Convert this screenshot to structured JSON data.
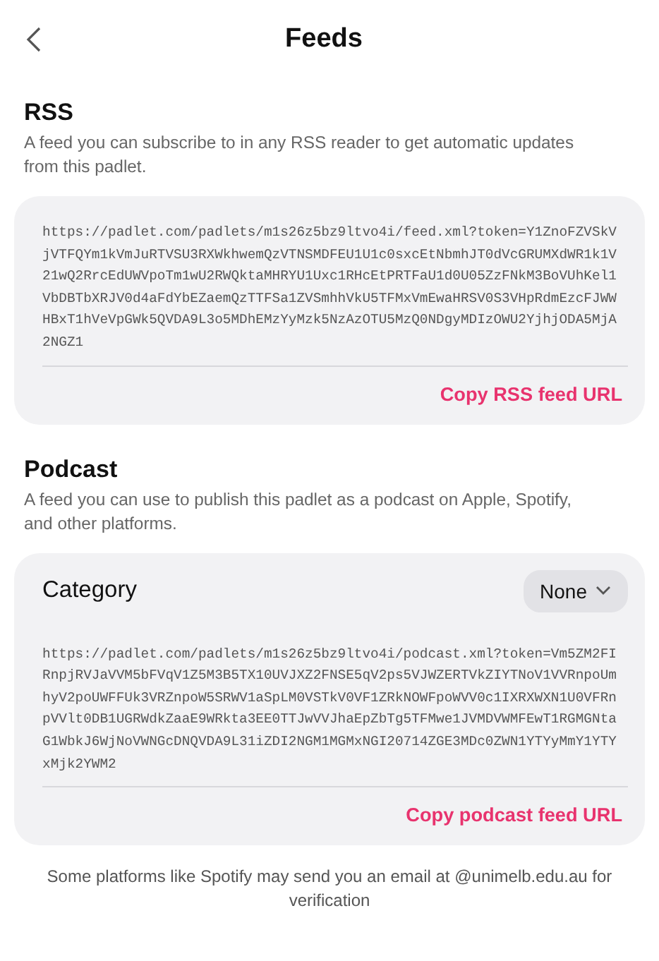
{
  "header": {
    "title": "Feeds"
  },
  "rss": {
    "heading": "RSS",
    "description": "A feed you can subscribe to in any RSS reader to get automatic updates from this padlet.",
    "url": "https://padlet.com/padlets/m1s26z5bz9ltvo4i/feed.xml?token=Y1ZnoFZVSkVjVTFQYm1kVmJuRTVSU3RXWkhwemQzVTNSMDFEU1U1c0sxcEtNbmhJT0dVcGRUMXdWR1k1V21wQ2RrcEdUWVpoTm1wU2RWQktaMHRYU1Uxc1RHcEtPRTFaU1d0U05ZzFNkM3BoVUhKel1VbDBTbXRJV0d4aFdYbEZaemQzTTFSa1ZVSmhhVkU5TFMxVmEwaHRSV0S3VHpRdmEzcFJWWHBxT1hVeVpGWk5QVDA9L3o5MDhEMzYyMzk5NzAzOTU5MzQ0NDgyMDIzOWU2YjhjODA5MjA2NGZ1",
    "copy_button": "Copy RSS feed URL"
  },
  "podcast": {
    "heading": "Podcast",
    "description": "A feed you can use to publish this padlet as a podcast on Apple, Spotify, and other platforms.",
    "category_label": "Category",
    "category_value": "None",
    "url": "https://padlet.com/padlets/m1s26z5bz9ltvo4i/podcast.xml?token=Vm5ZM2FIRnpjRVJaVVM5bFVqV1Z5M3B5TX10UVJXZ2FNSE5qV2ps5VJWZERTVkZIYTNoV1VVRnpoUmhyV2poUWFFUk3VRZnpoW5SRWV1aSpLM0VSTkV0VF1ZRkNOWFpoWVV0c1IXRXWXN1U0VFRnpVVlt0DB1UGRWdkZaaE9WRkta3EE0TTJwVVJhaEpZbTg5TFMwe1JVMDVWMFEwT1RGMGNtaG1WbkJ6WjNoVWNGcDNQVDA9L31iZDI2NGM1MGMxNGI20714ZGE3MDc0ZWN1YTYyMmY1YTYxMjk2YWM2",
    "copy_button": "Copy podcast feed URL"
  },
  "footer": {
    "note": "Some platforms like Spotify may send you an email at @unimelb.edu.au for verification"
  }
}
